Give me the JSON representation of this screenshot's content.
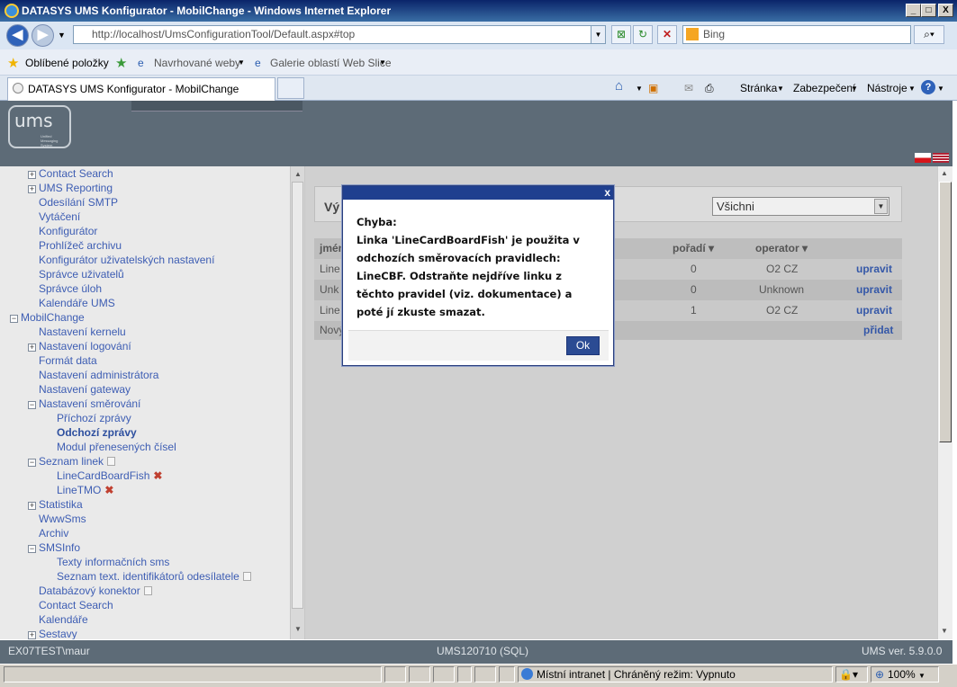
{
  "window": {
    "title": "DATASYS UMS Konfigurator - MobilChange - Windows Internet Explorer",
    "minimize": "_",
    "maximize": "□",
    "close": "X"
  },
  "browser": {
    "url": "http://localhost/UmsConfigurationTool/Default.aspx#top",
    "search_placeholder": "Bing",
    "favorites_label": "Oblíbené položky",
    "suggested_sites": "Navrhované weby",
    "web_slice_gallery": "Galerie oblastí Web Slice",
    "tab_title": "DATASYS UMS Konfigurator - MobilChange",
    "commands": {
      "page": "Stránka",
      "safety": "Zabezpečení",
      "tools": "Nástroje"
    }
  },
  "header": {
    "logo_text": "ums",
    "logo_subtext": "Unified\nMessaging\nSystem"
  },
  "sidebar": {
    "items": [
      {
        "label": "Contact Search",
        "toggle": "+"
      },
      {
        "label": "UMS Reporting",
        "toggle": "+"
      },
      {
        "label": "Odesílání SMTP"
      },
      {
        "label": "Vytáčení"
      },
      {
        "label": "Konfigurátor"
      },
      {
        "label": "Prohlížeč archivu"
      },
      {
        "label": "Konfigurátor uživatelských nastavení"
      },
      {
        "label": "Správce uživatelů"
      },
      {
        "label": "Správce úloh"
      },
      {
        "label": "Kalendáře UMS"
      },
      {
        "label": "MobilChange",
        "toggle": "−"
      },
      {
        "label": "Nastavení kernelu"
      },
      {
        "label": "Nastavení logování",
        "toggle": "+"
      },
      {
        "label": "Formát data"
      },
      {
        "label": "Nastavení administrátora"
      },
      {
        "label": "Nastavení gateway"
      },
      {
        "label": "Nastavení směrování",
        "toggle": "−"
      },
      {
        "label": "Příchozí zprávy"
      },
      {
        "label": "Odchozí zprávy"
      },
      {
        "label": "Modul přenesených čísel"
      },
      {
        "label": "Seznam linek",
        "toggle": "−"
      },
      {
        "label": "LineCardBoardFish"
      },
      {
        "label": "LineTMO"
      },
      {
        "label": "Statistika",
        "toggle": "+"
      },
      {
        "label": "WwwSms"
      },
      {
        "label": "Archiv"
      },
      {
        "label": "SMSInfo",
        "toggle": "−"
      },
      {
        "label": "Texty informačních sms"
      },
      {
        "label": "Seznam text. identifikátorů odesílatele"
      },
      {
        "label": "Databázový konektor"
      },
      {
        "label": "Contact Search"
      },
      {
        "label": "Kalendáře"
      },
      {
        "label": "Sestavy",
        "toggle": "+"
      }
    ]
  },
  "content": {
    "panel_title": "Vý",
    "filter_value": "Všichni",
    "table": {
      "headers": {
        "name": "jméno",
        "order": "pořadí",
        "operator": "operator"
      },
      "rows": [
        {
          "name": "Line",
          "order": "0",
          "operator": "O2 CZ",
          "action": "upravit"
        },
        {
          "name": "Unk",
          "order": "0",
          "operator": "Unknown",
          "action": "upravit"
        },
        {
          "name": "Line",
          "order": "1",
          "operator": "O2 CZ",
          "action": "upravit"
        }
      ],
      "new_row": {
        "name": "Nový",
        "action": "přidat"
      }
    }
  },
  "footer": {
    "user": "EX07TEST\\maur",
    "db": "UMS120710 (SQL)",
    "version": "UMS ver. 5.9.0.0"
  },
  "statusbar": {
    "zone": "Místní intranet | Chráněný režim: Vypnuto",
    "zoom": "100%"
  },
  "dialog": {
    "close": "x",
    "message": "Chyba:\nLinka 'LineCardBoardFish' je použita v odchozích směrovacích pravidlech: LineCBF. Odstraňte nejdříve linku z těchto pravidel (viz. dokumentace) a poté jí zkuste smazat.",
    "ok_label": "Ok"
  },
  "colors": {
    "header": "#5d6b77",
    "dialog_bar": "#1f3f8f",
    "link": "#3d5db3",
    "delete_icon": "#c04030"
  }
}
